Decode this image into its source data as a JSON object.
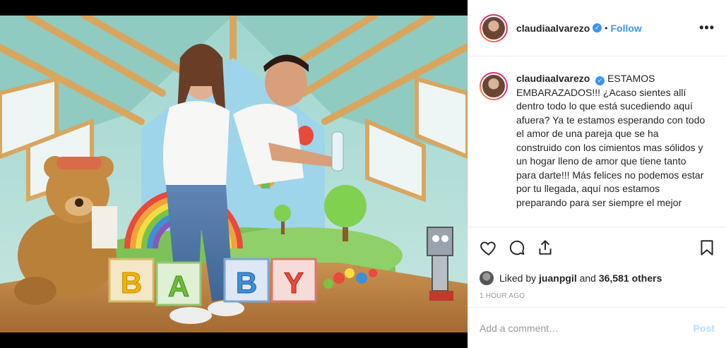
{
  "post": {
    "username": "claudiaalvarezo",
    "follow_label": "Follow",
    "separator": "•",
    "more_label": "•••",
    "verified_glyph": "✓",
    "caption": "ESTAMOS EMBARAZADOS!!! ¿Acaso sientes allí dentro todo lo que está sucediendo aquí afuera? Ya te estamos esperando con todo el amor de una pareja que se ha construido con los cimientos mas sólidos y un hogar lleno de amor que tiene tanto para darte!!! Más felices no podemos estar por tu llegada, aquí nos estamos preparando para ser siempre el mejor",
    "likes_prefix": "Liked by",
    "liked_by_user": "juanpgil",
    "likes_mid": "and",
    "likes_count": "36,581 others",
    "timestamp": "1 HOUR AGO",
    "comment_placeholder": "Add a comment…",
    "post_label": "Post"
  },
  "image": {
    "block_letters": [
      "B",
      "A",
      "B",
      "Y"
    ]
  },
  "colors": {
    "accent": "#3897f0",
    "post_disabled": "#b2dffc",
    "muted": "#999999"
  },
  "icons": [
    "heart-icon",
    "comment-icon",
    "share-icon",
    "bookmark-icon",
    "verified-icon",
    "more-icon"
  ]
}
